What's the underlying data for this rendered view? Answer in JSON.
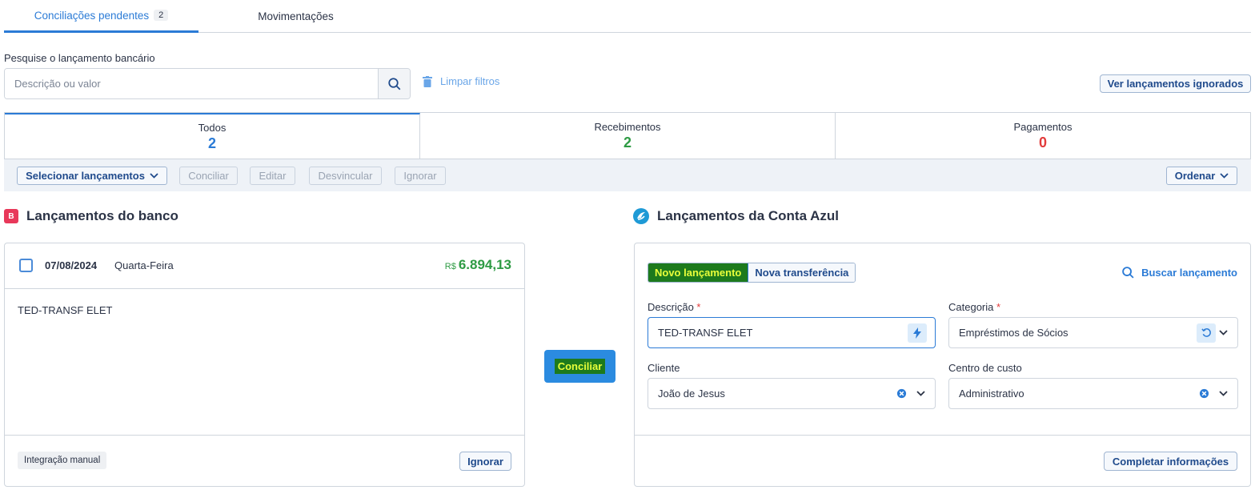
{
  "top_tabs": [
    {
      "label": "Conciliações pendentes",
      "badge": "2"
    },
    {
      "label": "Movimentações"
    }
  ],
  "search": {
    "label": "Pesquise o lançamento bancário",
    "placeholder": "Descrição ou valor",
    "clear_label": "Limpar filtros",
    "ignored_label": "Ver lançamentos ignorados"
  },
  "summary": [
    {
      "label": "Todos",
      "count": "2",
      "color": "#2b7bd6"
    },
    {
      "label": "Recebimentos",
      "count": "2",
      "color": "#2e9b44"
    },
    {
      "label": "Pagamentos",
      "count": "0",
      "color": "#e23b3b"
    }
  ],
  "actions": {
    "select": "Selecionar lançamentos",
    "conciliar": "Conciliar",
    "editar": "Editar",
    "desvincular": "Desvincular",
    "ignorar": "Ignorar",
    "ordenar": "Ordenar"
  },
  "bank": {
    "title": "Lançamentos do banco",
    "badge": "B",
    "date": "07/08/2024",
    "weekday": "Quarta-Feira",
    "currency": "R$",
    "amount": "6.894,13",
    "description": "TED-TRANSF ELET",
    "tag": "Integração manual",
    "ignore_label": "Ignorar"
  },
  "conciliar_label": "Conciliar",
  "conta_azul": {
    "title": "Lançamentos da Conta Azul",
    "seg_new": "Novo lançamento",
    "seg_transfer": "Nova transferência",
    "search_label": "Buscar lançamento",
    "desc_label": "Descrição",
    "desc_value": "TED-TRANSF ELET",
    "cat_label": "Categoria",
    "cat_value": "Empréstimos de Sócios",
    "client_label": "Cliente",
    "client_value": "João de Jesus",
    "cost_label": "Centro de custo",
    "cost_value": "Administrativo",
    "required_mark": "*",
    "complete_label": "Completar informações"
  }
}
